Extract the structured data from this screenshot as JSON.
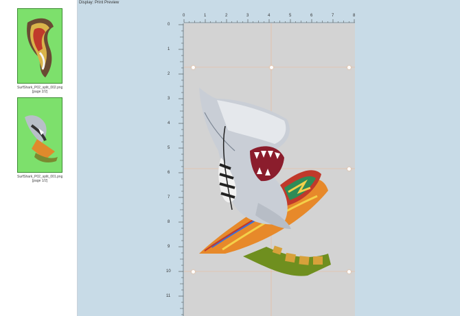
{
  "preview": {
    "display_label": "Display: Print Preview"
  },
  "thumbnails": [
    {
      "filename": "SurfShark_P02_split_002.png",
      "page": "[page 2/2]"
    },
    {
      "filename": "SurfShark_P02_split_001.png",
      "page": "[page 1/2]"
    }
  ],
  "rulers": {
    "top": [
      "0",
      "1",
      "2",
      "3",
      "4",
      "5",
      "6",
      "7",
      "8"
    ],
    "left": [
      "0",
      "1",
      "2",
      "3",
      "4",
      "5",
      "6",
      "7",
      "8",
      "9",
      "10",
      "11"
    ]
  },
  "icons": {
    "artwork": "surf-shark-artwork",
    "handle": "resize-handle-icon"
  },
  "colors": {
    "workspace": "#c8dbe7",
    "page": "#d3d3d3",
    "thumb_bg": "#7de06c",
    "guide": "#f0b48c"
  }
}
